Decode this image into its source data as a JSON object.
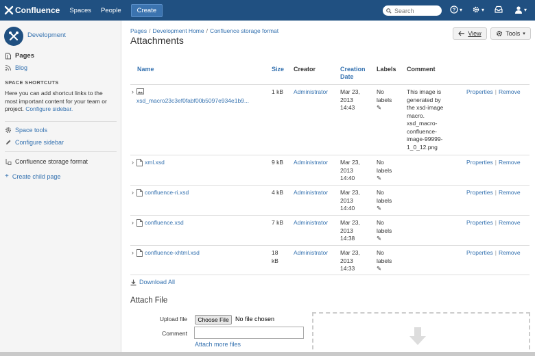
{
  "topbar": {
    "logo_text": "Confluence",
    "nav": [
      "Spaces",
      "People"
    ],
    "create_label": "Create",
    "search_placeholder": "Search",
    "accent": "#205081"
  },
  "sidebar": {
    "space_name": "Development",
    "pages_label": "Pages",
    "blog_label": "Blog",
    "shortcuts_heading": "SPACE SHORTCUTS",
    "shortcuts_text": "Here you can add shortcut links to the most important content for your team or project.",
    "configure_link": "Configure sidebar.",
    "space_tools": "Space tools",
    "configure_sidebar": "Configure sidebar",
    "current_page": "Confluence storage format",
    "create_child": "Create child page"
  },
  "breadcrumb": [
    "Pages",
    "Development Home",
    "Confluence storage format"
  ],
  "page_title": "Attachments",
  "buttons": {
    "view": "View",
    "tools": "Tools"
  },
  "table": {
    "headers": {
      "name": "Name",
      "size": "Size",
      "creator": "Creator",
      "creation_date_1": "Creation",
      "creation_date_2": "Date",
      "labels": "Labels",
      "comment": "Comment"
    },
    "rows": [
      {
        "name": "xsd_macro23c3ef0fabf00b5097e934e1b9...",
        "size": "1 kB",
        "creator": "Administrator",
        "date": [
          "Mar 23,",
          "2013",
          "14:43"
        ],
        "labels": [
          "No",
          "labels"
        ],
        "comment": [
          "This image is",
          "generated by",
          "the xsd-image",
          "macro.",
          "xsd_macro-",
          "confluence-",
          "image-99999-",
          "1_0_12.png"
        ],
        "properties": "Properties",
        "remove": "Remove",
        "icon": "image-file-icon"
      },
      {
        "name": "xml.xsd",
        "size": "9 kB",
        "creator": "Administrator",
        "date": [
          "Mar 23,",
          "2013",
          "14:40"
        ],
        "labels": [
          "No",
          "labels"
        ],
        "comment": [],
        "properties": "Properties",
        "remove": "Remove",
        "icon": "file-icon"
      },
      {
        "name": "confluence-ri.xsd",
        "size": "4 kB",
        "creator": "Administrator",
        "date": [
          "Mar 23,",
          "2013",
          "14:40"
        ],
        "labels": [
          "No",
          "labels"
        ],
        "comment": [],
        "properties": "Properties",
        "remove": "Remove",
        "icon": "file-icon"
      },
      {
        "name": "confluence.xsd",
        "size": "7 kB",
        "creator": "Administrator",
        "date": [
          "Mar 23,",
          "2013",
          "14:38"
        ],
        "labels": [
          "No",
          "labels"
        ],
        "comment": [],
        "properties": "Properties",
        "remove": "Remove",
        "icon": "file-icon"
      },
      {
        "name": "confluence-xhtml.xsd",
        "size": [
          "18",
          "kB"
        ],
        "creator": "Administrator",
        "date": [
          "Mar 23,",
          "2013",
          "14:33"
        ],
        "labels": [
          "No",
          "labels"
        ],
        "comment": [],
        "properties": "Properties",
        "remove": "Remove",
        "icon": "file-icon"
      }
    ]
  },
  "download_all": "Download All",
  "attach": {
    "title": "Attach File",
    "upload_label": "Upload file",
    "choose_button": "Choose File",
    "no_file": "No file chosen",
    "comment_label": "Comment",
    "attach_more": "Attach more files"
  }
}
